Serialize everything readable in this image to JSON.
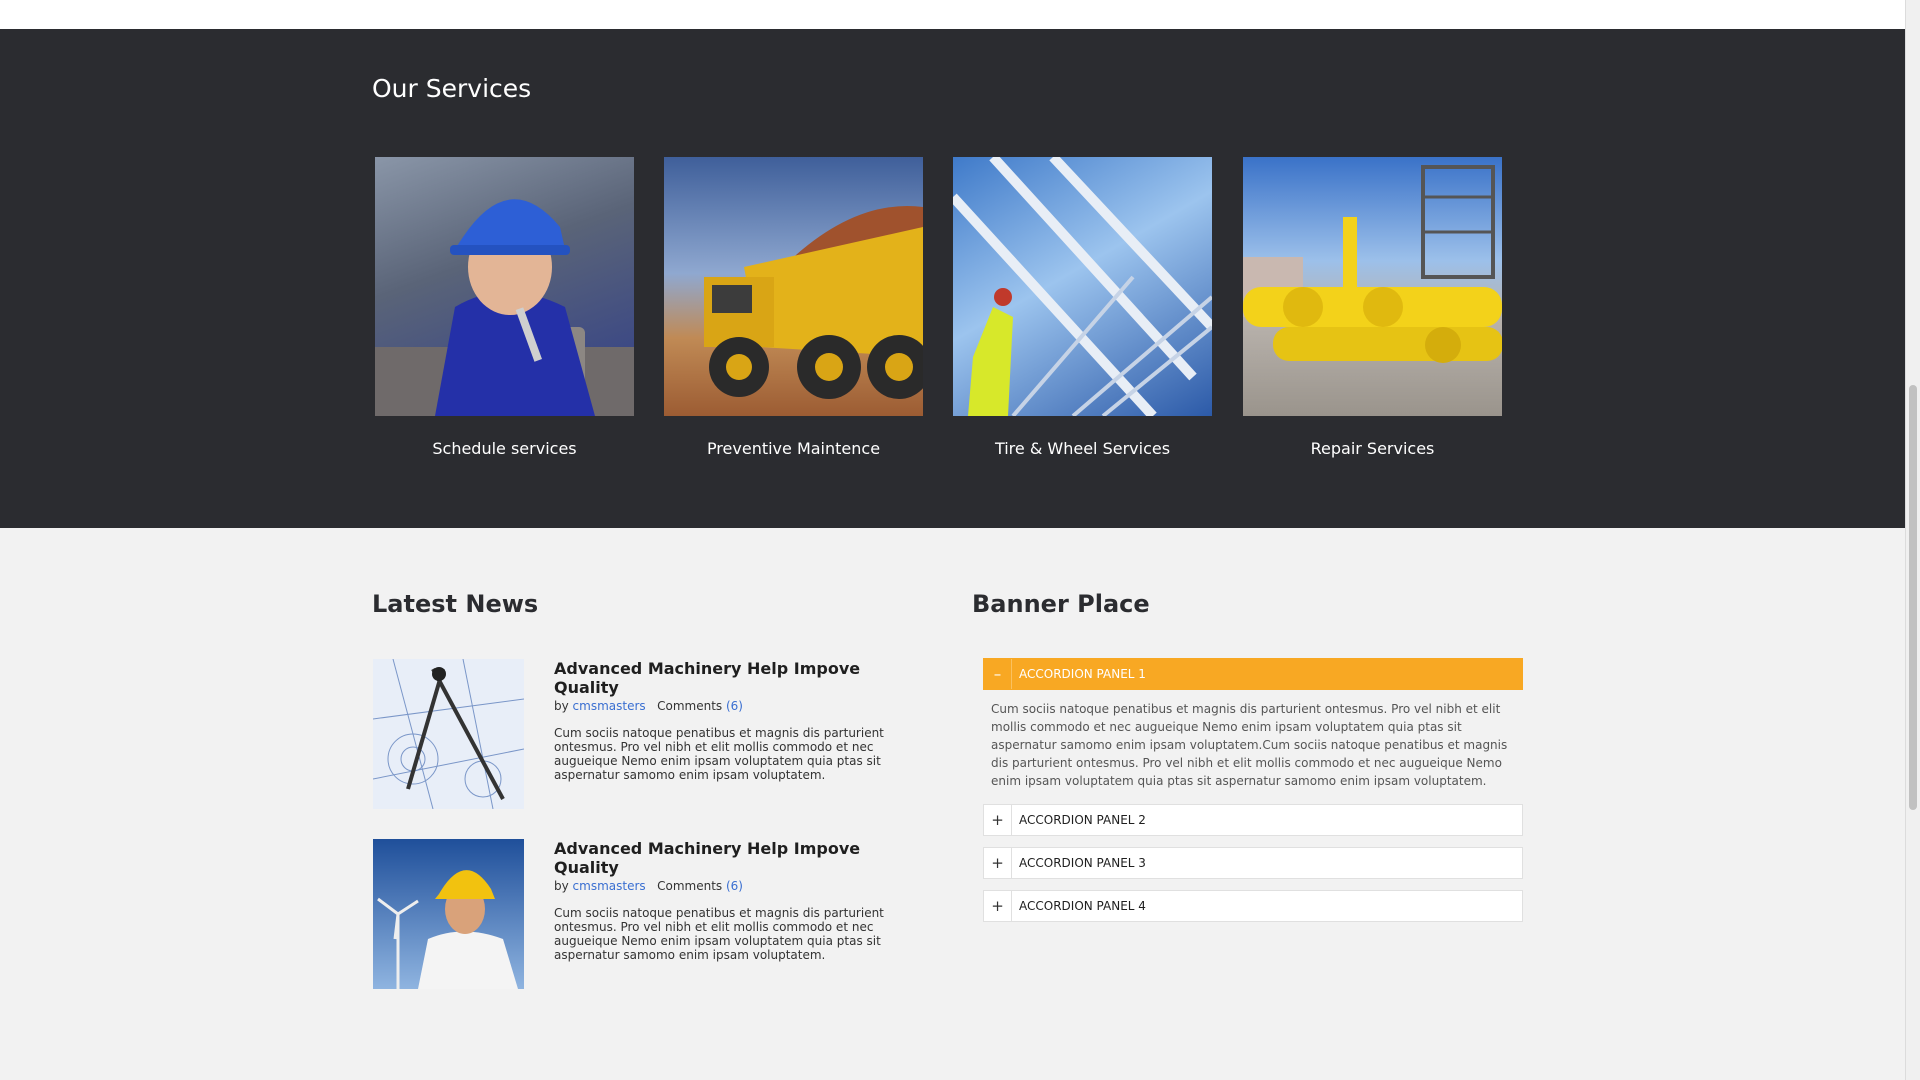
{
  "services": {
    "title": "Our Services",
    "items": [
      {
        "label": "Schedule services",
        "image": "engineer-helmet-photo"
      },
      {
        "label": "Preventive Maintence",
        "image": "dump-truck-photo"
      },
      {
        "label": "Tire & Wheel Services",
        "image": "industrial-pipes-photo"
      },
      {
        "label": "Repair Services",
        "image": "yellow-pipeline-photo"
      }
    ]
  },
  "news": {
    "title": "Latest News",
    "items": [
      {
        "title": "Advanced Machinery Help Impove Quality",
        "by": "by",
        "author": "cmsmasters",
        "comments_label": "Comments",
        "comments_count": "(6)",
        "excerpt": "Cum sociis natoque penatibus et magnis dis parturient ontesmus. Pro vel nibh et elit mollis commodo et nec augueique Nemo enim ipsam voluptatem quia ptas sit aspernatur samomo enim ipsam voluptatem.",
        "image": "blueprint-compass-photo"
      },
      {
        "title": "Advanced Machinery Help Impove Quality",
        "by": "by",
        "author": "cmsmasters",
        "comments_label": "Comments",
        "comments_count": "(6)",
        "excerpt": "Cum sociis natoque penatibus et magnis dis parturient ontesmus. Pro vel nibh et elit mollis commodo et nec augueique Nemo enim ipsam voluptatem quia ptas sit aspernatur samomo enim ipsam voluptatem.",
        "image": "worker-wind-turbine-photo"
      }
    ]
  },
  "banner": {
    "title": "Banner Place",
    "accordion": [
      {
        "label": "ACCORDION PANEL 1",
        "sign": "–",
        "open": true,
        "content": "Cum sociis natoque penatibus et magnis dis parturient ontesmus. Pro vel nibh et elit mollis commodo et nec augueique Nemo enim ipsam voluptatem quia ptas sit aspernatur samomo enim ipsam voluptatem.Cum sociis natoque penatibus et magnis dis parturient ontesmus. Pro vel nibh et elit mollis commodo et nec augueique Nemo enim ipsam voluptatem quia ptas sit aspernatur samomo enim ipsam voluptatem."
      },
      {
        "label": "ACCORDION PANEL 2",
        "sign": "+",
        "open": false
      },
      {
        "label": "ACCORDION PANEL 3",
        "sign": "+",
        "open": false
      },
      {
        "label": "ACCORDION PANEL 4",
        "sign": "+",
        "open": false
      }
    ]
  },
  "colors": {
    "accent": "#f8a823",
    "services_bg": "#2b2c30",
    "link": "#3a6fd1"
  }
}
